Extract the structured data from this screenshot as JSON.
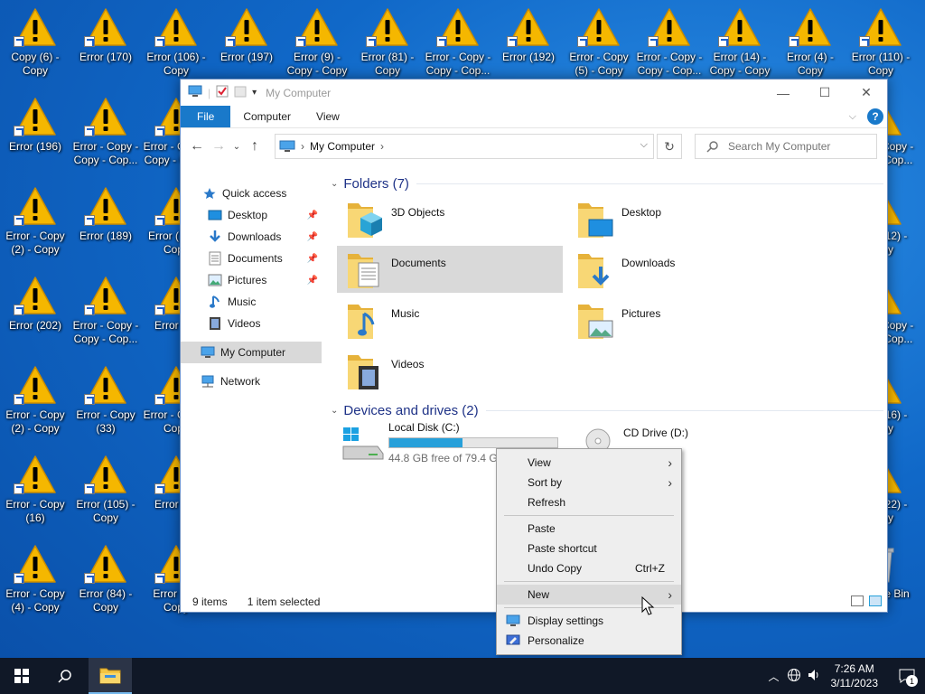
{
  "desktop": {
    "icons": [
      {
        "label": "Copy (6) - Copy",
        "col": 0,
        "row": 0,
        "type": "recycle"
      },
      {
        "label": "Error (170)",
        "col": 1,
        "row": 0
      },
      {
        "label": "Error (106) - Copy",
        "col": 2,
        "row": 0
      },
      {
        "label": "Error (197)",
        "col": 3,
        "row": 0
      },
      {
        "label": "Error (9) - Copy - Copy",
        "col": 4,
        "row": 0
      },
      {
        "label": "Error (81) - Copy",
        "col": 5,
        "row": 0
      },
      {
        "label": "Error - Copy - Copy - Cop...",
        "col": 6,
        "row": 0
      },
      {
        "label": "Error (192)",
        "col": 7,
        "row": 0
      },
      {
        "label": "Error - Copy (5) - Copy",
        "col": 8,
        "row": 0
      },
      {
        "label": "Error - Copy - Copy - Cop...",
        "col": 9,
        "row": 0
      },
      {
        "label": "Error (14) - Copy - Copy",
        "col": 10,
        "row": 0
      },
      {
        "label": "Error (4) - Copy",
        "col": 11,
        "row": 0
      },
      {
        "label": "Error (110) - Copy",
        "col": 12,
        "row": 0
      },
      {
        "label": "Error (196)",
        "col": 0,
        "row": 1
      },
      {
        "label": "Error - Copy - Copy - Cop...",
        "col": 1,
        "row": 1
      },
      {
        "label": "Error - Copy - Copy - Cop...",
        "col": 2,
        "row": 1
      },
      {
        "label": "Error - Copy - Copy - Cop...",
        "col": 12,
        "row": 1
      },
      {
        "label": "Error - Copy (2) - Copy",
        "col": 0,
        "row": 2
      },
      {
        "label": "Error (189)",
        "col": 1,
        "row": 2
      },
      {
        "label": "Error (1...) - Copy",
        "col": 2,
        "row": 2
      },
      {
        "label": "Error (12) - Copy",
        "col": 12,
        "row": 2
      },
      {
        "label": "Error (202)",
        "col": 0,
        "row": 3
      },
      {
        "label": "Error - Copy - Copy - Cop...",
        "col": 1,
        "row": 3
      },
      {
        "label": "Error (...)",
        "col": 2,
        "row": 3
      },
      {
        "label": "Error - Copy - Copy - Cop...",
        "col": 12,
        "row": 3
      },
      {
        "label": "Error - Copy (2) - Copy",
        "col": 0,
        "row": 4
      },
      {
        "label": "Error - Copy (33)",
        "col": 1,
        "row": 4
      },
      {
        "label": "Error - Copy - Copy",
        "col": 2,
        "row": 4
      },
      {
        "label": "Error (16) - Copy",
        "col": 12,
        "row": 4
      },
      {
        "label": "Error - Copy (16)",
        "col": 0,
        "row": 5
      },
      {
        "label": "Error (105) - Copy",
        "col": 1,
        "row": 5
      },
      {
        "label": "Error (...)",
        "col": 2,
        "row": 5
      },
      {
        "label": "Error (22) - Copy",
        "col": 12,
        "row": 5
      },
      {
        "label": "Error - Copy (4) - Copy",
        "col": 0,
        "row": 6
      },
      {
        "label": "Error (84) - Copy",
        "col": 1,
        "row": 6
      },
      {
        "label": "Error (... - Copy",
        "col": 2,
        "row": 6
      },
      {
        "label": "Recycle Bin",
        "col": 12,
        "row": 6,
        "type": "recycle"
      }
    ]
  },
  "explorer": {
    "title": "My Computer",
    "ribbon_tabs": [
      "File",
      "Computer",
      "View"
    ],
    "address": "My Computer",
    "search_placeholder": "Search My Computer",
    "nav": {
      "quick_access": "Quick access",
      "items": [
        "Desktop",
        "Downloads",
        "Documents",
        "Pictures",
        "Music",
        "Videos"
      ],
      "my_computer": "My Computer",
      "network": "Network"
    },
    "folders_header": "Folders (7)",
    "folders": [
      "3D Objects",
      "Desktop",
      "Documents",
      "Downloads",
      "Music",
      "Pictures",
      "Videos"
    ],
    "selected_folder": "Documents",
    "devices_header": "Devices and drives (2)",
    "drives": [
      {
        "name": "Local Disk (C:)",
        "free": "44.8 GB free of 79.4 GB",
        "used_fraction": 0.436
      },
      {
        "name": "CD Drive (D:)"
      }
    ],
    "status": {
      "items": "9 items",
      "selected": "1 item selected"
    }
  },
  "context_menu": {
    "items": [
      {
        "label": "View",
        "submenu": true
      },
      {
        "label": "Sort by",
        "submenu": true
      },
      {
        "label": "Refresh"
      },
      {
        "sep": true
      },
      {
        "label": "Paste"
      },
      {
        "label": "Paste shortcut"
      },
      {
        "label": "Undo Copy",
        "shortcut": "Ctrl+Z"
      },
      {
        "sep": true
      },
      {
        "label": "New",
        "submenu": true,
        "highlight": true
      },
      {
        "sep": true
      },
      {
        "label": "Display settings",
        "icon": "display-icon"
      },
      {
        "label": "Personalize",
        "icon": "personalize-icon"
      }
    ]
  },
  "taskbar": {
    "time": "7:26 AM",
    "date": "3/11/2023",
    "notification_count": "1"
  },
  "colors": {
    "accent": "#1979ca",
    "warning": "#f5b700"
  }
}
